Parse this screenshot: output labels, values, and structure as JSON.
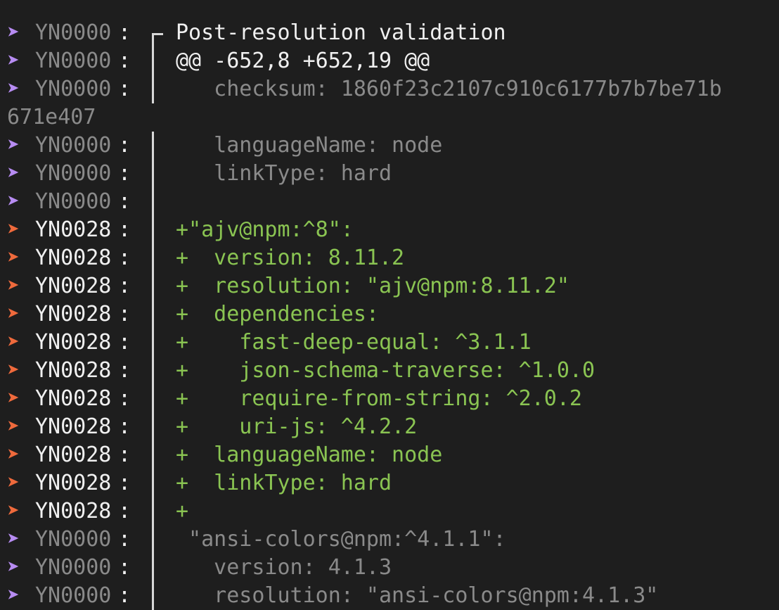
{
  "colors": {
    "background": "#1e1e1e",
    "info_arrow": "#b78cf2",
    "warning_arrow": "#ef6a3c",
    "dim_text": "#8a8a8a",
    "bright_text": "#f0f0f0",
    "added_text": "#8ac452"
  },
  "arrow_glyph": "➤",
  "colon": ":",
  "lines": [
    {
      "kind": "log",
      "level": "info",
      "code": "YN0000",
      "rail": "corner",
      "text": "Post-resolution validation",
      "style": "white"
    },
    {
      "kind": "log",
      "level": "info",
      "code": "YN0000",
      "rail": "bar",
      "text": "@@ -652,8 +652,19 @@",
      "style": "white"
    },
    {
      "kind": "log",
      "level": "info",
      "code": "YN0000",
      "rail": "bar",
      "text": "   checksum: 1860f23c2107c910c6177b7b7be71b",
      "style": "dim"
    },
    {
      "kind": "wrap",
      "text": "671e407",
      "style": "dim"
    },
    {
      "kind": "log",
      "level": "info",
      "code": "YN0000",
      "rail": "bar",
      "text": "   languageName: node",
      "style": "dim"
    },
    {
      "kind": "log",
      "level": "info",
      "code": "YN0000",
      "rail": "bar",
      "text": "   linkType: hard",
      "style": "dim"
    },
    {
      "kind": "log",
      "level": "info",
      "code": "YN0000",
      "rail": "bar",
      "text": "",
      "style": "dim"
    },
    {
      "kind": "log",
      "level": "warn",
      "code": "YN0028",
      "rail": "bar",
      "text": "+\"ajv@npm:^8\":",
      "style": "green"
    },
    {
      "kind": "log",
      "level": "warn",
      "code": "YN0028",
      "rail": "bar",
      "text": "+  version: 8.11.2",
      "style": "green"
    },
    {
      "kind": "log",
      "level": "warn",
      "code": "YN0028",
      "rail": "bar",
      "text": "+  resolution: \"ajv@npm:8.11.2\"",
      "style": "green"
    },
    {
      "kind": "log",
      "level": "warn",
      "code": "YN0028",
      "rail": "bar",
      "text": "+  dependencies:",
      "style": "green"
    },
    {
      "kind": "log",
      "level": "warn",
      "code": "YN0028",
      "rail": "bar",
      "text": "+    fast-deep-equal: ^3.1.1",
      "style": "green"
    },
    {
      "kind": "log",
      "level": "warn",
      "code": "YN0028",
      "rail": "bar",
      "text": "+    json-schema-traverse: ^1.0.0",
      "style": "green"
    },
    {
      "kind": "log",
      "level": "warn",
      "code": "YN0028",
      "rail": "bar",
      "text": "+    require-from-string: ^2.0.2",
      "style": "green"
    },
    {
      "kind": "log",
      "level": "warn",
      "code": "YN0028",
      "rail": "bar",
      "text": "+    uri-js: ^4.2.2",
      "style": "green"
    },
    {
      "kind": "log",
      "level": "warn",
      "code": "YN0028",
      "rail": "bar",
      "text": "+  languageName: node",
      "style": "green"
    },
    {
      "kind": "log",
      "level": "warn",
      "code": "YN0028",
      "rail": "bar",
      "text": "+  linkType: hard",
      "style": "green"
    },
    {
      "kind": "log",
      "level": "warn",
      "code": "YN0028",
      "rail": "bar",
      "text": "+",
      "style": "green"
    },
    {
      "kind": "log",
      "level": "info",
      "code": "YN0000",
      "rail": "bar",
      "text": " \"ansi-colors@npm:^4.1.1\":",
      "style": "dim"
    },
    {
      "kind": "log",
      "level": "info",
      "code": "YN0000",
      "rail": "bar",
      "text": "   version: 4.1.3",
      "style": "dim"
    },
    {
      "kind": "log",
      "level": "info",
      "code": "YN0000",
      "rail": "bar",
      "text": "   resolution: \"ansi-colors@npm:4.1.3\"",
      "style": "dim"
    }
  ]
}
